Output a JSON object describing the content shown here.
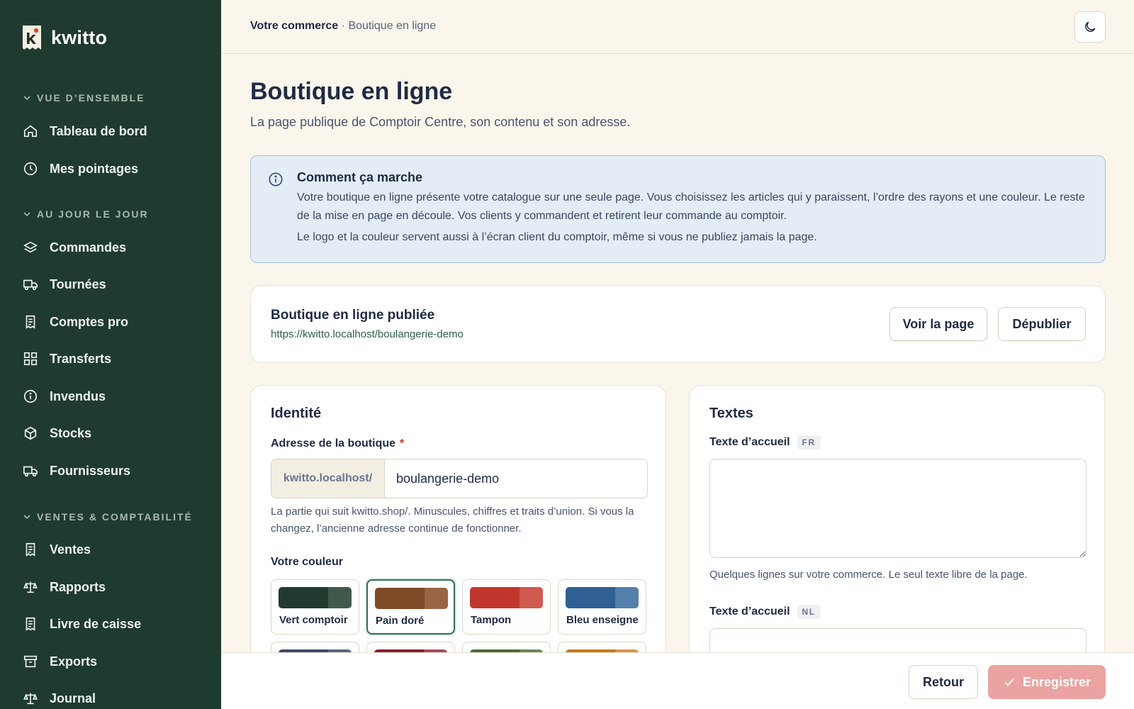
{
  "app": {
    "name": "kwitto"
  },
  "colors": {
    "sidebar_bg": "#1f3b2f",
    "accent": "#2f6f55",
    "save_disabled": "#eaa3a0"
  },
  "sidebar": {
    "sections": [
      {
        "label": "VUE D’ENSEMBLE",
        "items": [
          {
            "label": "Tableau de bord",
            "icon": "home-icon"
          },
          {
            "label": "Mes pointages",
            "icon": "clock-icon"
          }
        ]
      },
      {
        "label": "AU JOUR LE JOUR",
        "items": [
          {
            "label": "Commandes",
            "icon": "layers-icon"
          },
          {
            "label": "Tournées",
            "icon": "truck-icon"
          },
          {
            "label": "Comptes pro",
            "icon": "receipt-icon"
          },
          {
            "label": "Transferts",
            "icon": "grid-icon"
          },
          {
            "label": "Invendus",
            "icon": "info-icon"
          },
          {
            "label": "Stocks",
            "icon": "box-icon"
          },
          {
            "label": "Fournisseurs",
            "icon": "truck-icon"
          }
        ]
      },
      {
        "label": "VENTES & COMPTABILITÉ",
        "items": [
          {
            "label": "Ventes",
            "icon": "receipt-icon"
          },
          {
            "label": "Rapports",
            "icon": "scale-icon"
          },
          {
            "label": "Livre de caisse",
            "icon": "receipt-icon"
          },
          {
            "label": "Exports",
            "icon": "archive-icon"
          },
          {
            "label": "Journal",
            "icon": "scale-icon"
          }
        ]
      }
    ]
  },
  "breadcrumb": {
    "parent": "Votre commerce",
    "separator": "·",
    "current": "Boutique en ligne"
  },
  "header": {
    "theme_toggle_icon": "moon-icon"
  },
  "page": {
    "title": "Boutique en ligne",
    "subtitle": "La page publique de Comptoir Centre, son contenu et son adresse."
  },
  "info": {
    "title": "Comment ça marche",
    "p1": "Votre boutique en ligne présente votre catalogue sur une seule page. Vous choisissez les articles qui y paraissent, l’ordre des rayons et une couleur. Le reste de la mise en page en découle. Vos clients y commandent et retirent leur commande au comptoir.",
    "p2": "Le logo et la couleur servent aussi à l’écran client du comptoir, même si vous ne publiez jamais la page."
  },
  "publish": {
    "title": "Boutique en ligne publiée",
    "url": "https://kwitto.localhost/boulangerie-demo",
    "view_label": "Voir la page",
    "unpublish_label": "Dépublier"
  },
  "identity": {
    "title": "Identité",
    "address_label": "Adresse de la boutique",
    "required_mark": "*",
    "address_prefix": "kwitto.localhost/",
    "address_value": "boulangerie-demo",
    "address_help": "La partie qui suit kwitto.shop/. Minuscules, chiffres et traits d’union. Si vous la changez, l’ancienne adresse continue de fonctionner.",
    "color_label": "Votre couleur",
    "swatches": [
      {
        "label": "Vert comptoir",
        "main": "#22392f",
        "light": "#3f5a4d",
        "selected": false
      },
      {
        "label": "Pain doré",
        "main": "#7e4a28",
        "light": "#996546",
        "selected": true
      },
      {
        "label": "Tampon",
        "main": "#c2372d",
        "light": "#d05a50",
        "selected": false
      },
      {
        "label": "Bleu enseigne",
        "main": "#2f5f93",
        "light": "#5580ad",
        "selected": false
      },
      {
        "label": "",
        "main": "#3d4a6b",
        "light": "#5c6888",
        "selected": false
      },
      {
        "label": "",
        "main": "#8a1f34",
        "light": "#a64b5c",
        "selected": false
      },
      {
        "label": "",
        "main": "#4d6b36",
        "light": "#6b8655",
        "selected": false
      },
      {
        "label": "",
        "main": "#c87a1a",
        "light": "#d6954a",
        "selected": false
      }
    ]
  },
  "texts": {
    "title": "Textes",
    "welcome_label": "Texte d’accueil",
    "lang_fr": "FR",
    "lang_nl": "NL",
    "welcome_help": "Quelques lignes sur votre commerce. Le seul texte libre de la page."
  },
  "footer": {
    "back_label": "Retour",
    "save_label": "Enregistrer"
  }
}
